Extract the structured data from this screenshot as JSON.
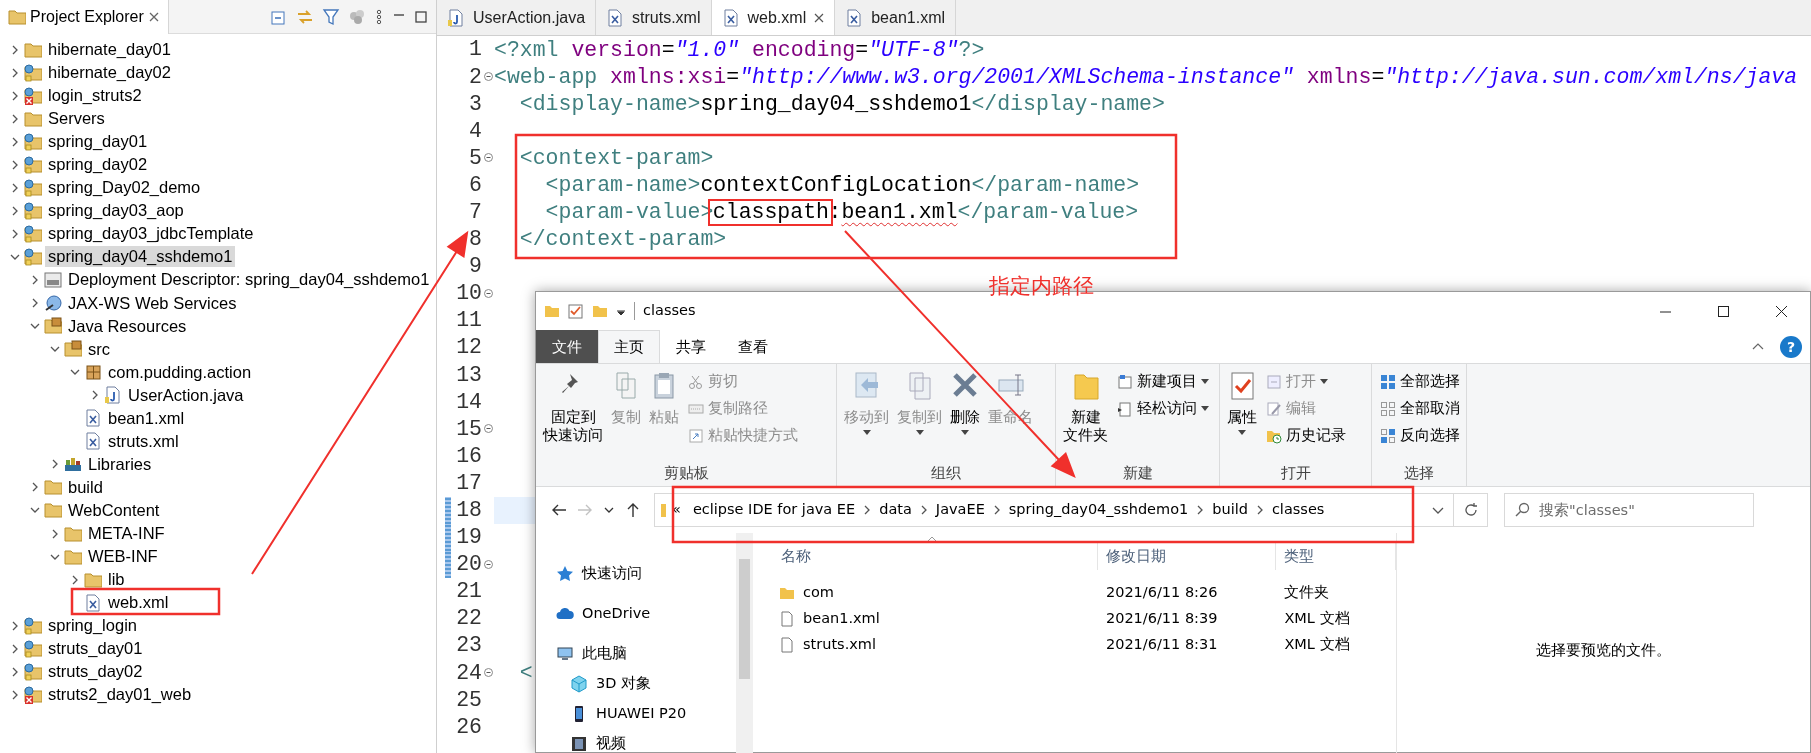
{
  "project_explorer": {
    "title": "Project Explorer",
    "tree": [
      {
        "label": "hibernate_day01",
        "kind": "folder",
        "expanded": false,
        "selected": false
      },
      {
        "label": "hibernate_day02",
        "kind": "project",
        "expanded": false,
        "selected": false
      },
      {
        "label": "login_struts2",
        "kind": "project-error",
        "expanded": false,
        "selected": false
      },
      {
        "label": "Servers",
        "kind": "folder",
        "expanded": false,
        "selected": false
      },
      {
        "label": "spring_day01",
        "kind": "project",
        "expanded": false,
        "selected": false
      },
      {
        "label": "spring_day02",
        "kind": "project",
        "expanded": false,
        "selected": false
      },
      {
        "label": "spring_Day02_demo",
        "kind": "project",
        "expanded": false,
        "selected": false
      },
      {
        "label": "spring_day03_aop",
        "kind": "project",
        "expanded": false,
        "selected": false
      },
      {
        "label": "spring_day03_jdbcTemplate",
        "kind": "project",
        "expanded": false,
        "selected": false
      },
      {
        "label": "spring_day04_sshdemo1",
        "kind": "project",
        "expanded": true,
        "selected": true,
        "children": [
          {
            "label": "Deployment Descriptor: spring_day04_sshdemo1",
            "kind": "descriptor",
            "expanded": false,
            "selected": false
          },
          {
            "label": "JAX-WS Web Services",
            "kind": "webservices",
            "expanded": false,
            "selected": false
          },
          {
            "label": "Java Resources",
            "kind": "package-folder",
            "expanded": true,
            "selected": false,
            "children": [
              {
                "label": "src",
                "kind": "package-folder",
                "expanded": true,
                "selected": false,
                "children": [
                  {
                    "label": "com.pudding.action",
                    "kind": "package",
                    "expanded": true,
                    "selected": false,
                    "children": [
                      {
                        "label": "UserAction.java",
                        "kind": "java",
                        "expanded": false,
                        "selected": false
                      }
                    ]
                  },
                  {
                    "label": "bean1.xml",
                    "kind": "xml",
                    "selected": false
                  },
                  {
                    "label": "struts.xml",
                    "kind": "xml",
                    "selected": false
                  }
                ]
              },
              {
                "label": "Libraries",
                "kind": "books",
                "expanded": false,
                "selected": false
              }
            ]
          },
          {
            "label": "build",
            "kind": "folder",
            "expanded": false,
            "selected": false
          },
          {
            "label": "WebContent",
            "kind": "folder",
            "expanded": true,
            "selected": false,
            "children": [
              {
                "label": "META-INF",
                "kind": "folder",
                "expanded": false,
                "selected": false
              },
              {
                "label": "WEB-INF",
                "kind": "folder",
                "expanded": true,
                "selected": false,
                "children": [
                  {
                    "label": "lib",
                    "kind": "folder",
                    "expanded": false,
                    "selected": false
                  },
                  {
                    "label": "web.xml",
                    "kind": "xml",
                    "selected": false
                  }
                ]
              }
            ]
          }
        ]
      },
      {
        "label": "spring_login",
        "kind": "project",
        "expanded": false,
        "selected": false
      },
      {
        "label": "struts_day01",
        "kind": "project",
        "expanded": false,
        "selected": false
      },
      {
        "label": "struts_day02",
        "kind": "project",
        "expanded": false,
        "selected": false
      },
      {
        "label": "struts2_day01_web",
        "kind": "project-error",
        "expanded": false,
        "selected": false
      }
    ]
  },
  "editor": {
    "tabs": [
      {
        "label": "UserAction.java",
        "kind": "java",
        "selected": false
      },
      {
        "label": "struts.xml",
        "kind": "xml",
        "selected": false
      },
      {
        "label": "web.xml",
        "kind": "xml",
        "selected": true
      },
      {
        "label": "bean1.xml",
        "kind": "xml",
        "selected": false
      }
    ],
    "lines": [
      {
        "number": "1",
        "fold": false,
        "changed": false,
        "current": false,
        "segments": [
          {
            "kind": "tag",
            "text": "<?xml"
          },
          {
            "kind": "attr",
            "text": " version"
          },
          {
            "kind": "text",
            "text": "="
          },
          {
            "kind": "value",
            "text": "\"1.0\""
          },
          {
            "kind": "attr",
            "text": " encoding"
          },
          {
            "kind": "text",
            "text": "="
          },
          {
            "kind": "value",
            "text": "\"UTF-8\""
          },
          {
            "kind": "tag",
            "text": "?>"
          }
        ]
      },
      {
        "number": "2",
        "fold": true,
        "changed": false,
        "current": false,
        "segments": [
          {
            "kind": "tag",
            "text": "<web-app"
          },
          {
            "kind": "attr",
            "text": " xmlns:xsi"
          },
          {
            "kind": "text",
            "text": "="
          },
          {
            "kind": "value",
            "text": "\"http://www.w3.org/2001/XMLSchema-instance\""
          },
          {
            "kind": "attr",
            "text": " xmlns"
          },
          {
            "kind": "text",
            "text": "="
          },
          {
            "kind": "value",
            "text": "\"http://java.sun.com/xml/ns/java"
          }
        ]
      },
      {
        "number": "3",
        "fold": false,
        "changed": false,
        "current": false,
        "segments": [
          {
            "kind": "tag",
            "text": "  <display-name>"
          },
          {
            "kind": "text",
            "text": "spring_day04_sshdemo1"
          },
          {
            "kind": "tag",
            "text": "</display-name>"
          }
        ]
      },
      {
        "number": "4",
        "fold": false,
        "changed": false,
        "current": false
      },
      {
        "number": "5",
        "fold": true,
        "changed": false,
        "current": false,
        "segments": [
          {
            "kind": "tag",
            "text": "  <context-param>"
          }
        ]
      },
      {
        "number": "6",
        "fold": false,
        "changed": false,
        "current": false,
        "segments": [
          {
            "kind": "tag",
            "text": "    <param-name>"
          },
          {
            "kind": "text",
            "text": "contextConfigLocation"
          },
          {
            "kind": "tag",
            "text": "</param-name>"
          }
        ]
      },
      {
        "number": "7",
        "fold": false,
        "changed": false,
        "current": false,
        "segments": [
          {
            "kind": "tag",
            "text": "    <param-value>"
          },
          {
            "kind": "text",
            "text": "classpath",
            "boxed": true
          },
          {
            "kind": "text",
            "text": ":"
          },
          {
            "kind": "text",
            "text": "bean1.xml",
            "squiggle": true
          },
          {
            "kind": "tag",
            "text": "</param-value>"
          }
        ]
      },
      {
        "number": "8",
        "fold": false,
        "changed": false,
        "current": false,
        "segments": [
          {
            "kind": "tag",
            "text": "  </context-param>"
          }
        ]
      },
      {
        "number": "9",
        "fold": false,
        "changed": false,
        "current": false
      },
      {
        "number": "10",
        "fold": true,
        "changed": false,
        "current": false
      },
      {
        "number": "11",
        "fold": false,
        "changed": false,
        "current": false
      },
      {
        "number": "12",
        "fold": false,
        "changed": false,
        "current": false
      },
      {
        "number": "13",
        "fold": false,
        "changed": false,
        "current": false
      },
      {
        "number": "14",
        "fold": false,
        "changed": false,
        "current": false
      },
      {
        "number": "15",
        "fold": true,
        "changed": false,
        "current": false
      },
      {
        "number": "16",
        "fold": false,
        "changed": false,
        "current": false
      },
      {
        "number": "17",
        "fold": false,
        "changed": false,
        "current": false
      },
      {
        "number": "18",
        "fold": false,
        "changed": true,
        "current": true
      },
      {
        "number": "19",
        "fold": false,
        "changed": true,
        "current": false
      },
      {
        "number": "20",
        "fold": true,
        "changed": true,
        "current": false
      },
      {
        "number": "21",
        "fold": false,
        "changed": false,
        "current": false
      },
      {
        "number": "22",
        "fold": false,
        "changed": false,
        "current": false
      },
      {
        "number": "23",
        "fold": false,
        "changed": false,
        "current": false
      },
      {
        "number": "24",
        "fold": true,
        "changed": false,
        "current": false,
        "segments": [
          {
            "kind": "tag",
            "text": "  <"
          }
        ]
      },
      {
        "number": "25",
        "fold": false,
        "changed": false,
        "current": false
      },
      {
        "number": "26",
        "fold": false,
        "changed": false,
        "current": false
      }
    ]
  },
  "file_explorer": {
    "title": "classes",
    "tabs": [
      {
        "label": "文件",
        "kind": "file",
        "selected": false
      },
      {
        "label": "主页",
        "kind": "normal",
        "selected": true
      },
      {
        "label": "共享",
        "kind": "normal",
        "selected": false
      },
      {
        "label": "查看",
        "kind": "normal",
        "selected": false
      }
    ],
    "help": "?",
    "ribbon": [
      {
        "label": "剪贴板",
        "items": [
          {
            "lines": [
              "固定到",
              "快速访问"
            ],
            "kind": "pin",
            "disabled": false,
            "dropdown": false
          },
          {
            "label": "复制",
            "kind": "copy",
            "disabled": true,
            "dropdown": false
          },
          {
            "label": "粘贴",
            "kind": "paste",
            "disabled": true,
            "dropdown": false
          },
          {
            "label": "剪切",
            "kind": "cut",
            "disabled": true,
            "dropdown": false
          },
          {
            "label": "复制路径",
            "kind": "path",
            "disabled": true,
            "dropdown": false
          },
          {
            "label": "粘贴快捷方式",
            "kind": "shortcut",
            "disabled": true,
            "dropdown": false
          }
        ]
      },
      {
        "label": "组织",
        "items": [
          {
            "label": "移动到",
            "kind": "move",
            "disabled": true,
            "dropdown": true
          },
          {
            "label": "复制到",
            "kind": "copyto",
            "disabled": true,
            "dropdown": true
          },
          {
            "label": "删除",
            "kind": "delete",
            "disabled": false,
            "dropdown": true
          },
          {
            "label": "重命名",
            "kind": "rename",
            "disabled": true,
            "dropdown": false
          }
        ]
      },
      {
        "label": "新建",
        "items": [
          {
            "lines": [
              "新建",
              "文件夹"
            ],
            "kind": "newfolder",
            "disabled": false,
            "dropdown": false
          },
          {
            "label": "新建项目",
            "kind": "newitem",
            "disabled": false,
            "dropdown": true
          },
          {
            "label": "轻松访问",
            "kind": "easy",
            "disabled": false,
            "dropdown": true
          }
        ]
      },
      {
        "label": "打开",
        "items": [
          {
            "label": "属性",
            "kind": "properties",
            "disabled": false,
            "dropdown": true
          },
          {
            "label": "打开",
            "kind": "open",
            "disabled": true,
            "dropdown": true
          },
          {
            "label": "编辑",
            "kind": "edit",
            "disabled": true,
            "dropdown": false
          },
          {
            "label": "历史记录",
            "kind": "history",
            "disabled": false,
            "dropdown": false
          }
        ]
      },
      {
        "label": "选择",
        "items": [
          {
            "label": "全部选择",
            "kind": "selectall",
            "disabled": false,
            "dropdown": false
          },
          {
            "label": "全部取消",
            "kind": "selectnone",
            "disabled": false,
            "dropdown": false
          },
          {
            "label": "反向选择",
            "kind": "invert",
            "disabled": false,
            "dropdown": false
          }
        ]
      }
    ],
    "nav_buttons": [
      {
        "kind": "back",
        "disabled": false
      },
      {
        "kind": "forward",
        "disabled": true
      },
      {
        "kind": "recent",
        "disabled": false
      },
      {
        "kind": "up",
        "disabled": false
      }
    ],
    "breadcrumb": {
      "overflow": "«",
      "parts": [
        "eclipse IDE for java EE",
        "data",
        "JavaEE",
        "spring_day04_sshdemo1",
        "build",
        "classes"
      ]
    },
    "search": {
      "placeholder": "搜索\"classes\""
    },
    "nav_pane": [
      {
        "label": "快速访问",
        "kind": "star"
      },
      {
        "label": "OneDrive",
        "kind": "cloud"
      },
      {
        "label": "此电脑",
        "kind": "pc",
        "children": [
          {
            "label": "3D 对象",
            "kind": "cube"
          },
          {
            "label": "HUAWEI P20",
            "kind": "phone"
          },
          {
            "label": "视频",
            "kind": "film"
          }
        ]
      }
    ],
    "columns": [
      "名称",
      "修改日期",
      "类型"
    ],
    "files": [
      {
        "name": "com",
        "modified": "2021/6/11 8:26",
        "type": "文件夹",
        "kind": "folder"
      },
      {
        "name": "bean1.xml",
        "modified": "2021/6/11 8:39",
        "type": "XML 文档",
        "kind": "file"
      },
      {
        "name": "struts.xml",
        "modified": "2021/6/11 8:31",
        "type": "XML 文档",
        "kind": "file"
      }
    ],
    "preview": "选择要预览的文件。"
  },
  "annotation": {
    "label": "指定内路径"
  }
}
